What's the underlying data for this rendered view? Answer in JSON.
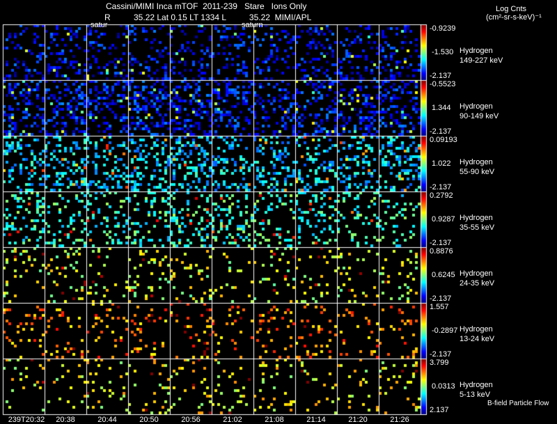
{
  "header": {
    "title_line1": "Cassini/MIMI Inca mTOF  2011-239   Stare   Ions Only",
    "title_line2": "R          35.22 Lat 0.15 LT 1334 L          35.22  MIMI/APL",
    "overlay_label_1": "satur",
    "overlay_label_2": "saturn",
    "units_line1": "Log Cnts",
    "units_line2": "(cm²-sr-s-keV)⁻¹"
  },
  "footer_note": "B-field Particle Flow",
  "chart_data": {
    "type": "heatmap",
    "title": "Cassini/MIMI Inca mTOF 2011-239 Stare Ions Only",
    "x_ticks": [
      "239T20:32",
      "20:38",
      "20:44",
      "20:50",
      "20:56",
      "21:02",
      "21:08",
      "21:14",
      "21:20",
      "21:26"
    ],
    "colorbar_label": "Log Cnts (cm²-sr-s-keV)⁻¹",
    "rows": [
      {
        "species": "Hydrogen",
        "energy": "149-227 keV",
        "cb_max": "-0.9239",
        "cb_mid": "-1.530",
        "cb_min": "-2.137",
        "density": 0.22,
        "level": 0.12
      },
      {
        "species": "Hydrogen",
        "energy": "90-149 keV",
        "cb_max": "-0.5523",
        "cb_mid": "1.344",
        "cb_min": "-2.137",
        "density": 0.32,
        "level": 0.14
      },
      {
        "species": "Hydrogen",
        "energy": "55-90 keV",
        "cb_max": "0.09193",
        "cb_mid": "1.022",
        "cb_min": "-2.137",
        "density": 0.28,
        "level": 0.33
      },
      {
        "species": "Hydrogen",
        "energy": "35-55 keV",
        "cb_max": "0.2792",
        "cb_mid": "0.9287",
        "cb_min": "-2.137",
        "density": 0.2,
        "level": 0.42
      },
      {
        "species": "Hydrogen",
        "energy": "24-35 keV",
        "cb_max": "0.8876",
        "cb_mid": "0.6245",
        "cb_min": "-2.137",
        "density": 0.1,
        "level": 0.58
      },
      {
        "species": "Hydrogen",
        "energy": "13-24 keV",
        "cb_max": "1.557",
        "cb_mid": "-0.2897",
        "cb_min": "-2.137",
        "density": 0.1,
        "level": 0.74
      },
      {
        "species": "Hydrogen",
        "energy": "5-13 keV",
        "cb_max": "3.799",
        "cb_mid": "0.0313",
        "cb_min": "2.137",
        "density": 0.09,
        "level": 0.62
      }
    ]
  }
}
